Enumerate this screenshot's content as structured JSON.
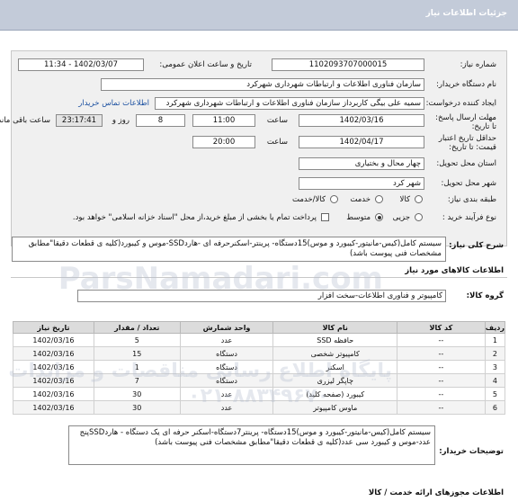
{
  "header": {
    "title": "جزئیات اطلاعات نیاز"
  },
  "labels": {
    "need_number": "شماره نیاز:",
    "announce_datetime": "تاریخ و ساعت اعلان عمومی:",
    "buyer_org": "نام دستگاه خریدار:",
    "creator": "ایجاد کننده درخواست:",
    "contact_link": "اطلاعات تماس خریدار",
    "reply_deadline": "مهلت ارسال پاسخ: تا تاریخ:",
    "hour": "ساعت",
    "day_and": "روز و",
    "remaining": "ساعت باقی مانده",
    "validity": "حداقل تاریخ اعتبار قیمت: تا تاریخ:",
    "delivery_province": "استان محل تحویل:",
    "delivery_city": "شهر محل تحویل:",
    "category": "طبقه بندی نیاز:",
    "purchase_type": "نوع فرآیند خرید :",
    "general_desc": "شرح کلی نیاز:",
    "goods_info": "اطلاعات کالاهای مورد نیاز",
    "goods_group": "گروه کالا:",
    "buyer_notes": "توضیحات خریدار:",
    "licenses": "اطلاعات مجوزهای ارائه خدمت / کالا"
  },
  "values": {
    "need_number": "1102093707000015",
    "announce_datetime": "1402/03/07 - 11:34",
    "buyer_org": "سازمان فناوری اطلاعات و ارتباطات شهرداری شهرکرد",
    "creator": "سمیه علی بیگی کاربرداز سازمان فناوری اطلاعات و ارتباطات شهرداری شهرکرد",
    "reply_date": "1402/03/16",
    "reply_hour": "11:00",
    "days_left": "8",
    "time_left": "23:17:41",
    "validity_date": "1402/04/17",
    "validity_hour": "20:00",
    "province": "چهار محال و بختیاری",
    "city": "شهر کرد",
    "goods_group": "کامپیوتر و فناوری اطلاعات-سخت افزار",
    "general_desc": "سیستم کامل(کیس-مانیتور-کیبورد و موس)15دستگاه- پرینتر-اسکنرحرفه ای -هاردSSD-موس و کیبورد(کلیه ی قطعات دقیقا\"مطابق مشخصات فنی پیوست باشد)",
    "buyer_notes": "سیستم کامل(کیس-مانیتور-کیبورد و موس)15دستگاه- پرینتر7دستگاه-اسکنر حرفه ای یک دستگاه - هاردSSDپنج عدد-موس و کیبورد سی عدد(کلیه ی قطعات دقیقا\"مطابق مشخصات فنی پیوست باشد)"
  },
  "category_options": [
    {
      "label": "کالا",
      "selected": false
    },
    {
      "label": "خدمت",
      "selected": false
    },
    {
      "label": "کالا/خدمت",
      "selected": false
    }
  ],
  "purchase_options": [
    {
      "label": "جزیی",
      "selected": false
    },
    {
      "label": "متوسط",
      "selected": true
    }
  ],
  "payment_note": "پرداخت تمام یا بخشی از مبلغ خرید،از محل \"اسناد خزانه اسلامی\" خواهد بود.",
  "table": {
    "headers": [
      "ردیف",
      "کد کالا",
      "نام کالا",
      "واحد شمارش",
      "تعداد / مقدار",
      "تاریخ نیاز"
    ],
    "rows": [
      [
        "1",
        "--",
        "حافظه SSD",
        "عدد",
        "5",
        "1402/03/16"
      ],
      [
        "2",
        "--",
        "کامپیوتر شخصی",
        "دستگاه",
        "15",
        "1402/03/16"
      ],
      [
        "3",
        "--",
        "اسکنر",
        "دستگاه",
        "1",
        "1402/03/16"
      ],
      [
        "4",
        "--",
        "چاپگر لیزری",
        "دستگاه",
        "7",
        "1402/03/16"
      ],
      [
        "5",
        "--",
        "کیبورد (صفحه کلید)",
        "عدد",
        "30",
        "1402/03/16"
      ],
      [
        "6",
        "--",
        "ماوس کامپیوتر",
        "عدد",
        "30",
        "1402/03/16"
      ]
    ]
  },
  "watermark": {
    "brand": "ParsNamadari.com",
    "line": "پایگاه اطلاع رسانی مناقصات و مزایدات",
    "phone": "۰۲۱-۸۸۳۴۹۶۷۰"
  }
}
